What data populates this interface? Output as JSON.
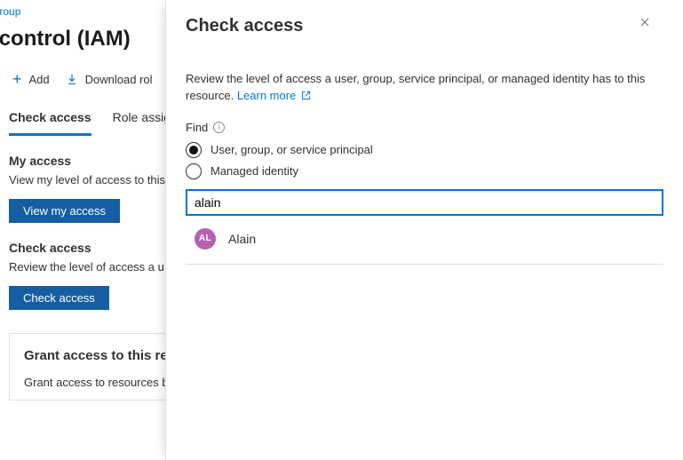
{
  "breadcrumb": {
    "last": "e-group"
  },
  "page": {
    "title_fragment": "ess control (IAM)",
    "toolbar": {
      "add": "Add",
      "download": "Download rol"
    },
    "tabs": {
      "check_access": "Check access",
      "role_assign": "Role assign"
    },
    "my_access": {
      "heading": "My access",
      "desc": "View my level of access to this",
      "button": "View my access"
    },
    "check_access": {
      "heading": "Check access",
      "desc": "Review the level of access a u",
      "button": "Check access"
    },
    "grant_card": {
      "heading": "Grant access to this re",
      "desc": "Grant access to resources b"
    }
  },
  "panel": {
    "title": "Check access",
    "description": "Review the level of access a user, group, service principal, or managed identity has to this resource. ",
    "learn_more": "Learn more",
    "find_label": "Find",
    "radios": {
      "ugsp": "User, group, or service principal",
      "mi": "Managed identity",
      "selected": "ugsp"
    },
    "search": {
      "value": "alain",
      "placeholder": ""
    },
    "result": {
      "initials": "AL",
      "name": "Alain"
    }
  }
}
